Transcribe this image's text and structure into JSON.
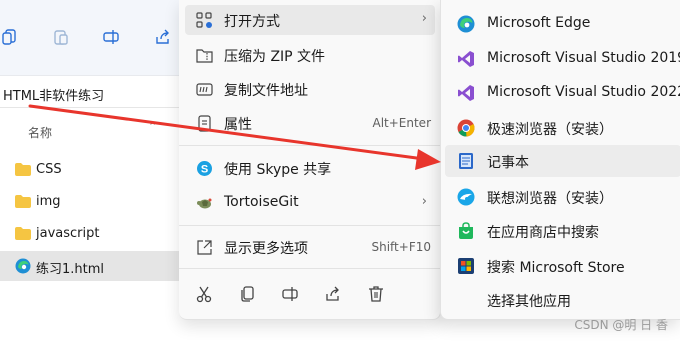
{
  "explorer": {
    "address": "HTML非软件练习",
    "column_name": "名称",
    "files": [
      {
        "label": "CSS",
        "type": "folder"
      },
      {
        "label": "img",
        "type": "folder"
      },
      {
        "label": "javascript",
        "type": "folder"
      },
      {
        "label": "练习1.html",
        "type": "edge-html",
        "selected": true
      }
    ]
  },
  "context_menu": {
    "items": [
      {
        "label": "打开方式",
        "icon": "open-with-icon",
        "submenu": true
      },
      {
        "label": "压缩为 ZIP 文件",
        "icon": "zip-icon"
      },
      {
        "label": "复制文件地址",
        "icon": "copy-path-icon"
      },
      {
        "label": "属性",
        "icon": "properties-icon",
        "shortcut": "Alt+Enter"
      },
      {
        "label": "使用 Skype 共享",
        "icon": "skype-icon"
      },
      {
        "label": "TortoiseGit",
        "icon": "tortoisegit-icon",
        "submenu": true
      },
      {
        "label": "显示更多选项",
        "icon": "more-options-icon",
        "shortcut": "Shift+F10"
      }
    ],
    "arrow_glyph": "›",
    "bottom_icons": [
      "cut-icon",
      "copy-icon",
      "rename-icon",
      "share-icon",
      "delete-icon"
    ]
  },
  "submenu": {
    "items": [
      {
        "label": "Microsoft Edge",
        "icon": "edge-icon"
      },
      {
        "label": "Microsoft Visual Studio 2019",
        "icon": "visual-studio-icon"
      },
      {
        "label": "Microsoft Visual Studio 2022",
        "icon": "visual-studio-icon"
      },
      {
        "label": "极速浏览器（安装）",
        "icon": "chrome-icon"
      },
      {
        "label": "记事本",
        "icon": "notepad-icon",
        "highlighted": true
      },
      {
        "label": "联想浏览器（安装）",
        "icon": "lenovo-browser-icon"
      },
      {
        "label": "在应用商店中搜索",
        "icon": "store-icon"
      },
      {
        "label": "搜索 Microsoft Store",
        "icon": "microsoft-store-icon"
      },
      {
        "label": "选择其他应用",
        "icon": "none"
      }
    ]
  },
  "annotation": {
    "color": "#e8352c",
    "target": "记事本"
  },
  "watermark": "CSDN @明 日 香",
  "colors": {
    "folder": "#f5c542",
    "vs_purple": "#8a4fd0",
    "edge_blue": "#1f8fd4",
    "notepad_blue": "#2b68c9"
  }
}
